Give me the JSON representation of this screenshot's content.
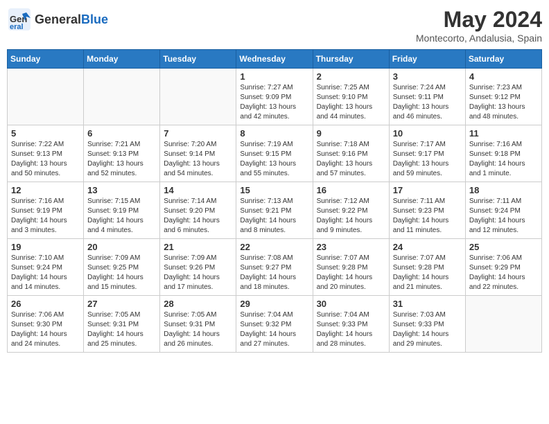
{
  "header": {
    "logo_general": "General",
    "logo_blue": "Blue",
    "month_year": "May 2024",
    "location": "Montecorto, Andalusia, Spain"
  },
  "days_of_week": [
    "Sunday",
    "Monday",
    "Tuesday",
    "Wednesday",
    "Thursday",
    "Friday",
    "Saturday"
  ],
  "weeks": [
    [
      {
        "day": null,
        "info": null
      },
      {
        "day": null,
        "info": null
      },
      {
        "day": null,
        "info": null
      },
      {
        "day": "1",
        "info": "Sunrise: 7:27 AM\nSunset: 9:09 PM\nDaylight: 13 hours\nand 42 minutes."
      },
      {
        "day": "2",
        "info": "Sunrise: 7:25 AM\nSunset: 9:10 PM\nDaylight: 13 hours\nand 44 minutes."
      },
      {
        "day": "3",
        "info": "Sunrise: 7:24 AM\nSunset: 9:11 PM\nDaylight: 13 hours\nand 46 minutes."
      },
      {
        "day": "4",
        "info": "Sunrise: 7:23 AM\nSunset: 9:12 PM\nDaylight: 13 hours\nand 48 minutes."
      }
    ],
    [
      {
        "day": "5",
        "info": "Sunrise: 7:22 AM\nSunset: 9:13 PM\nDaylight: 13 hours\nand 50 minutes."
      },
      {
        "day": "6",
        "info": "Sunrise: 7:21 AM\nSunset: 9:13 PM\nDaylight: 13 hours\nand 52 minutes."
      },
      {
        "day": "7",
        "info": "Sunrise: 7:20 AM\nSunset: 9:14 PM\nDaylight: 13 hours\nand 54 minutes."
      },
      {
        "day": "8",
        "info": "Sunrise: 7:19 AM\nSunset: 9:15 PM\nDaylight: 13 hours\nand 55 minutes."
      },
      {
        "day": "9",
        "info": "Sunrise: 7:18 AM\nSunset: 9:16 PM\nDaylight: 13 hours\nand 57 minutes."
      },
      {
        "day": "10",
        "info": "Sunrise: 7:17 AM\nSunset: 9:17 PM\nDaylight: 13 hours\nand 59 minutes."
      },
      {
        "day": "11",
        "info": "Sunrise: 7:16 AM\nSunset: 9:18 PM\nDaylight: 14 hours\nand 1 minute."
      }
    ],
    [
      {
        "day": "12",
        "info": "Sunrise: 7:16 AM\nSunset: 9:19 PM\nDaylight: 14 hours\nand 3 minutes."
      },
      {
        "day": "13",
        "info": "Sunrise: 7:15 AM\nSunset: 9:19 PM\nDaylight: 14 hours\nand 4 minutes."
      },
      {
        "day": "14",
        "info": "Sunrise: 7:14 AM\nSunset: 9:20 PM\nDaylight: 14 hours\nand 6 minutes."
      },
      {
        "day": "15",
        "info": "Sunrise: 7:13 AM\nSunset: 9:21 PM\nDaylight: 14 hours\nand 8 minutes."
      },
      {
        "day": "16",
        "info": "Sunrise: 7:12 AM\nSunset: 9:22 PM\nDaylight: 14 hours\nand 9 minutes."
      },
      {
        "day": "17",
        "info": "Sunrise: 7:11 AM\nSunset: 9:23 PM\nDaylight: 14 hours\nand 11 minutes."
      },
      {
        "day": "18",
        "info": "Sunrise: 7:11 AM\nSunset: 9:24 PM\nDaylight: 14 hours\nand 12 minutes."
      }
    ],
    [
      {
        "day": "19",
        "info": "Sunrise: 7:10 AM\nSunset: 9:24 PM\nDaylight: 14 hours\nand 14 minutes."
      },
      {
        "day": "20",
        "info": "Sunrise: 7:09 AM\nSunset: 9:25 PM\nDaylight: 14 hours\nand 15 minutes."
      },
      {
        "day": "21",
        "info": "Sunrise: 7:09 AM\nSunset: 9:26 PM\nDaylight: 14 hours\nand 17 minutes."
      },
      {
        "day": "22",
        "info": "Sunrise: 7:08 AM\nSunset: 9:27 PM\nDaylight: 14 hours\nand 18 minutes."
      },
      {
        "day": "23",
        "info": "Sunrise: 7:07 AM\nSunset: 9:28 PM\nDaylight: 14 hours\nand 20 minutes."
      },
      {
        "day": "24",
        "info": "Sunrise: 7:07 AM\nSunset: 9:28 PM\nDaylight: 14 hours\nand 21 minutes."
      },
      {
        "day": "25",
        "info": "Sunrise: 7:06 AM\nSunset: 9:29 PM\nDaylight: 14 hours\nand 22 minutes."
      }
    ],
    [
      {
        "day": "26",
        "info": "Sunrise: 7:06 AM\nSunset: 9:30 PM\nDaylight: 14 hours\nand 24 minutes."
      },
      {
        "day": "27",
        "info": "Sunrise: 7:05 AM\nSunset: 9:31 PM\nDaylight: 14 hours\nand 25 minutes."
      },
      {
        "day": "28",
        "info": "Sunrise: 7:05 AM\nSunset: 9:31 PM\nDaylight: 14 hours\nand 26 minutes."
      },
      {
        "day": "29",
        "info": "Sunrise: 7:04 AM\nSunset: 9:32 PM\nDaylight: 14 hours\nand 27 minutes."
      },
      {
        "day": "30",
        "info": "Sunrise: 7:04 AM\nSunset: 9:33 PM\nDaylight: 14 hours\nand 28 minutes."
      },
      {
        "day": "31",
        "info": "Sunrise: 7:03 AM\nSunset: 9:33 PM\nDaylight: 14 hours\nand 29 minutes."
      },
      {
        "day": null,
        "info": null
      }
    ]
  ]
}
